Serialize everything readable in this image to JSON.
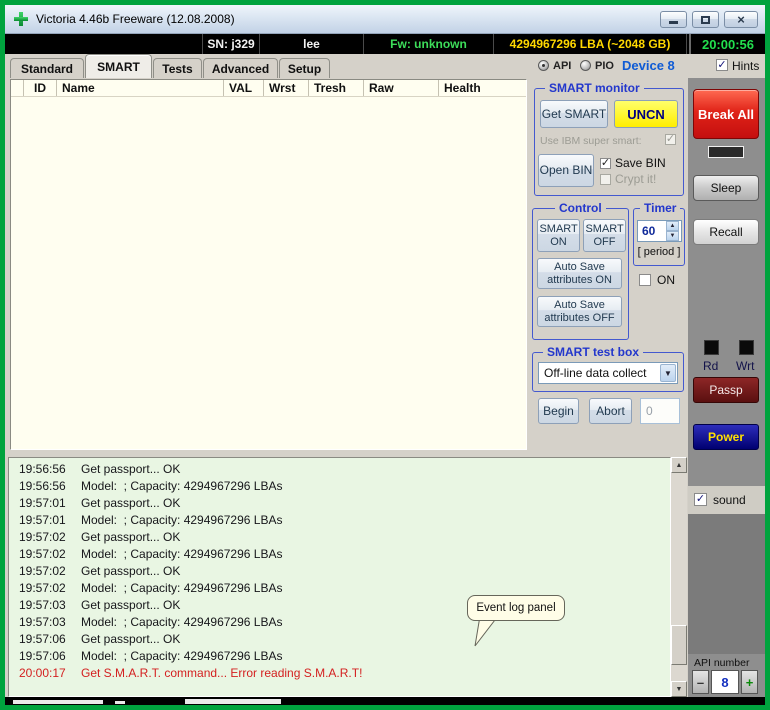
{
  "window": {
    "title": "Victoria 4.46b Freeware (12.08.2008)"
  },
  "drive_bar": {
    "sn": "SN: j329",
    "owner": "lee",
    "firmware": "Fw: unknown",
    "capacity": "4294967296 LBA (~2048 GB)",
    "clock": "20:00:56"
  },
  "tabs": [
    {
      "label": "Standard"
    },
    {
      "label": "SMART"
    },
    {
      "label": "Tests"
    },
    {
      "label": "Advanced"
    },
    {
      "label": "Setup"
    }
  ],
  "mode_bar": {
    "api": "API",
    "pio": "PIO",
    "device": "Device 8",
    "hints": "Hints"
  },
  "smart_table": {
    "headers": [
      "ID",
      "Name",
      "VAL",
      "Wrst",
      "Tresh",
      "Raw",
      "Health"
    ]
  },
  "smart_monitor": {
    "title": "SMART monitor",
    "get_smart": "Get SMART",
    "uncn": "UNCN",
    "use_ibm_label": "Use IBM super smart:",
    "open_bin": "Open BIN",
    "save_bin": "Save BIN",
    "crypt_it": "Crypt it!"
  },
  "control_group": {
    "title": "Control",
    "smart_on": "SMART ON",
    "smart_off": "SMART OFF",
    "autosave_on": "Auto Save attributes ON",
    "autosave_off": "Auto Save attributes OFF"
  },
  "timer_group": {
    "title": "Timer",
    "value": "60",
    "period": "[ period ]",
    "on_label": "ON"
  },
  "test_box": {
    "title": "SMART test box",
    "selected": "Off-line data collect",
    "begin": "Begin",
    "abort": "Abort",
    "counter": "0"
  },
  "side_panel": {
    "break_all": "Break All",
    "sleep": "Sleep",
    "recall": "Recall",
    "rd": "Rd",
    "wrt": "Wrt",
    "passp": "Passp",
    "power": "Power",
    "sound": "sound",
    "api_number_label": "API number",
    "api_value": "8"
  },
  "log": {
    "tooltip": "Event log panel",
    "entries": [
      {
        "time": "19:56:56",
        "text": "Get passport... OK",
        "error": false
      },
      {
        "time": "19:56:56",
        "text": "Model:  ; Capacity: 4294967296 LBAs",
        "error": false
      },
      {
        "time": "19:57:01",
        "text": "Get passport... OK",
        "error": false
      },
      {
        "time": "19:57:01",
        "text": "Model:  ; Capacity: 4294967296 LBAs",
        "error": false
      },
      {
        "time": "19:57:02",
        "text": "Get passport... OK",
        "error": false
      },
      {
        "time": "19:57:02",
        "text": "Model:  ; Capacity: 4294967296 LBAs",
        "error": false
      },
      {
        "time": "19:57:02",
        "text": "Get passport... OK",
        "error": false
      },
      {
        "time": "19:57:02",
        "text": "Model:  ; Capacity: 4294967296 LBAs",
        "error": false
      },
      {
        "time": "19:57:03",
        "text": "Get passport... OK",
        "error": false
      },
      {
        "time": "19:57:03",
        "text": "Model:  ; Capacity: 4294967296 LBAs",
        "error": false
      },
      {
        "time": "19:57:06",
        "text": "Get passport... OK",
        "error": false
      },
      {
        "time": "19:57:06",
        "text": "Model:  ; Capacity: 4294967296 LBAs",
        "error": false
      },
      {
        "time": "20:00:17",
        "text": "Get S.M.A.R.T. command... Error reading S.M.A.R.T!",
        "error": true
      }
    ]
  },
  "icons": {
    "check": "✓",
    "arrow_up": "▲",
    "arrow_down": "▼",
    "close": "×",
    "minus": "–",
    "plus": "+"
  },
  "colors": {
    "frame_green": "#00A33E",
    "group_border_blue": "#4459cf",
    "uncn_yellow": "#ffee00",
    "break_all_red": "#e02318",
    "power_navy": "#000070",
    "passp_maroon": "#5a1010",
    "capacity_yellow": "#ffd800",
    "firmware_green": "#3ddc5a",
    "log_background": "#E9F6E3",
    "error_red": "#d42020",
    "table_cream": "#FFFEF0"
  }
}
